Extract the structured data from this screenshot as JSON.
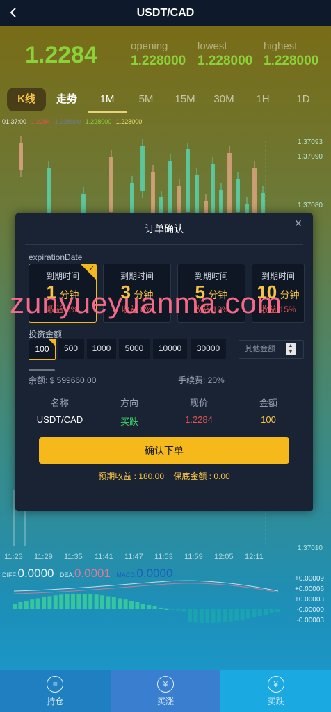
{
  "header": {
    "title": "USDT/CAD"
  },
  "price": {
    "current": "1.2284",
    "stats": [
      {
        "label": "opening",
        "value": "1.228000"
      },
      {
        "label": "lowest",
        "value": "1.228000"
      },
      {
        "label": "highest",
        "value": "1.228000"
      }
    ]
  },
  "tabs": [
    "K线",
    "走势",
    "1M",
    "5M",
    "15M",
    "30M",
    "1H",
    "1D"
  ],
  "ohlc": {
    "time": "01:37:00",
    "v1": "1.2284",
    "v2": "1.228000",
    "v3": "1.228000",
    "v4": "1.228000"
  },
  "chart_axis": [
    "1.37093",
    "1.37090",
    "1.37080",
    "1.37010"
  ],
  "time_axis": [
    "11:23",
    "11:29",
    "11:35",
    "11:41",
    "11:47",
    "11:53",
    "11:59",
    "12:05",
    "12:11"
  ],
  "macd": {
    "diff_label": "DIFF:",
    "diff_value": "0.0000",
    "dea_label": "DEA:",
    "dea_value": "0.0001",
    "macd_label": "MACD:",
    "macd_value": "0.0000",
    "axis": [
      "+0.00009",
      "+0.00006",
      "+0.00003",
      "-0.00000",
      "-0.00003"
    ]
  },
  "bottom_nav": [
    {
      "label": "持仓",
      "icon": "coin-stack-icon"
    },
    {
      "label": "买涨",
      "icon": "yen-up-icon"
    },
    {
      "label": "买跌",
      "icon": "yen-down-icon"
    }
  ],
  "modal": {
    "title": "订单确认",
    "expiration_label": "expirationDate",
    "cards": [
      {
        "title": "到期时间",
        "num": "1",
        "unit": "分钟",
        "rate": "收益 5%"
      },
      {
        "title": "到期时间",
        "num": "3",
        "unit": "分钟",
        "rate": "收益 8%"
      },
      {
        "title": "到期时间",
        "num": "5",
        "unit": "分钟",
        "rate": "收益 10%"
      },
      {
        "title": "到期时间",
        "num": "10",
        "unit": "分钟",
        "rate": "收益 15%"
      }
    ],
    "invest_label": "投资金额",
    "amounts": [
      "100",
      "500",
      "1000",
      "5000",
      "10000",
      "30000"
    ],
    "other_placeholder": "其他金额",
    "balance": "余额: $ 599660.00",
    "fee": "手续费: 20%",
    "table_headers": [
      "名称",
      "方向",
      "现价",
      "金额"
    ],
    "table_values": [
      "USDT/CAD",
      "买跌",
      "1.2284",
      "100"
    ],
    "confirm_button": "确认下单",
    "expected": "预期收益 : 180.00    保底金额 : 0.00"
  },
  "watermark": "zunyueyuanma.com",
  "colors": {
    "green": "#8bd13a",
    "gold": "#f5c445",
    "red": "#e2524f",
    "modal_bg": "#1a2333"
  }
}
